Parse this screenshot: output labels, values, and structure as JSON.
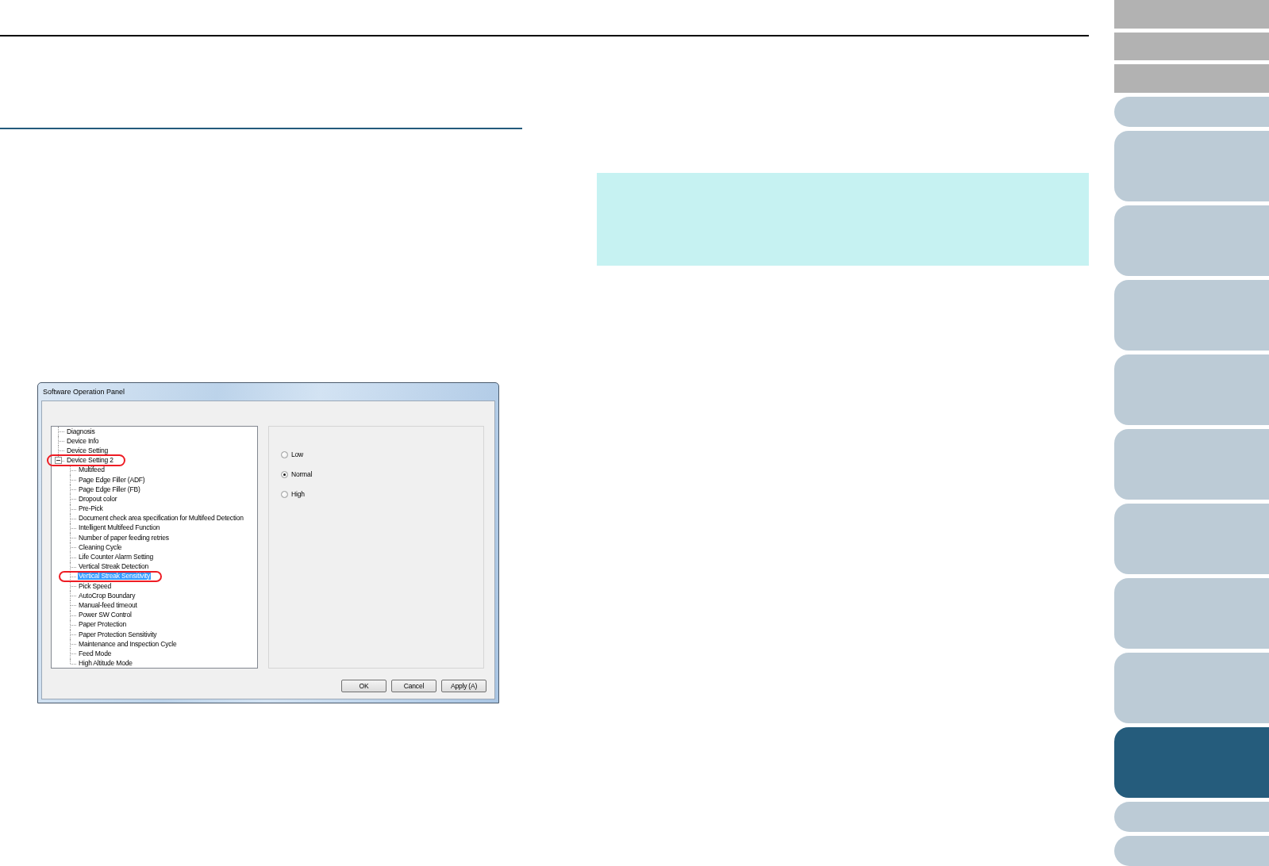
{
  "side_tabs": [
    {
      "kind": "header",
      "selected": false
    },
    {
      "kind": "header",
      "selected": false
    },
    {
      "kind": "header",
      "selected": false
    },
    {
      "kind": "short",
      "selected": false
    },
    {
      "kind": "tall",
      "selected": false
    },
    {
      "kind": "tall",
      "selected": false
    },
    {
      "kind": "tall",
      "selected": false
    },
    {
      "kind": "tall",
      "selected": false
    },
    {
      "kind": "tall",
      "selected": false
    },
    {
      "kind": "tall",
      "selected": false
    },
    {
      "kind": "tall",
      "selected": false
    },
    {
      "kind": "tall",
      "selected": false
    },
    {
      "kind": "tall",
      "selected": true
    },
    {
      "kind": "short",
      "selected": false
    },
    {
      "kind": "short",
      "selected": false
    }
  ],
  "dialog": {
    "title": "Software Operation Panel",
    "tree": [
      {
        "label": "Diagnosis",
        "selected": false,
        "circled": false
      },
      {
        "label": "Device Info",
        "selected": false,
        "circled": false
      },
      {
        "label": "Device Setting",
        "selected": false,
        "circled": false
      },
      {
        "label": "Device Setting 2",
        "selected": false,
        "circled": true,
        "expanded": true,
        "children": [
          {
            "label": "Multifeed",
            "selected": false,
            "circled": false
          },
          {
            "label": "Page Edge Filler (ADF)",
            "selected": false,
            "circled": false
          },
          {
            "label": "Page Edge Filler (FB)",
            "selected": false,
            "circled": false
          },
          {
            "label": "Dropout color",
            "selected": false,
            "circled": false
          },
          {
            "label": "Pre-Pick",
            "selected": false,
            "circled": false
          },
          {
            "label": "Document check area specification for Multifeed Detection",
            "selected": false,
            "circled": false
          },
          {
            "label": "Intelligent Multifeed Function",
            "selected": false,
            "circled": false
          },
          {
            "label": "Number of paper feeding retries",
            "selected": false,
            "circled": false
          },
          {
            "label": "Cleaning Cycle",
            "selected": false,
            "circled": false
          },
          {
            "label": "Life Counter Alarm Setting",
            "selected": false,
            "circled": false
          },
          {
            "label": "Vertical Streak Detection",
            "selected": false,
            "circled": false
          },
          {
            "label": "Vertical Streak Sensitivity",
            "selected": true,
            "circled": true
          },
          {
            "label": "Pick Speed",
            "selected": false,
            "circled": false
          },
          {
            "label": "AutoCrop Boundary",
            "selected": false,
            "circled": false
          },
          {
            "label": "Manual-feed timeout",
            "selected": false,
            "circled": false
          },
          {
            "label": "Power SW Control",
            "selected": false,
            "circled": false
          },
          {
            "label": "Paper Protection",
            "selected": false,
            "circled": false
          },
          {
            "label": "Paper Protection Sensitivity",
            "selected": false,
            "circled": false
          },
          {
            "label": "Maintenance and Inspection Cycle",
            "selected": false,
            "circled": false
          },
          {
            "label": "Feed Mode",
            "selected": false,
            "circled": false
          },
          {
            "label": "High Altitude Mode",
            "selected": false,
            "circled": false
          }
        ]
      }
    ],
    "options": [
      {
        "label": "Low",
        "selected": false
      },
      {
        "label": "Normal",
        "selected": true
      },
      {
        "label": "High",
        "selected": false
      }
    ],
    "buttons": [
      "OK",
      "Cancel",
      "Apply (A)"
    ]
  }
}
